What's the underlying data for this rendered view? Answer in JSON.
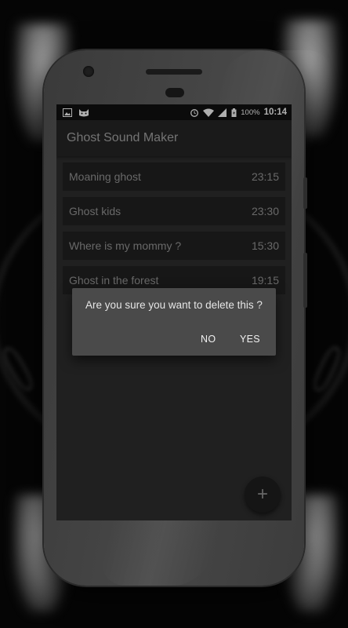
{
  "status_bar": {
    "battery": "100%",
    "time": "10:14"
  },
  "app_bar": {
    "title": "Ghost Sound Maker"
  },
  "recordings": [
    {
      "name": "Moaning ghost",
      "duration": "23:15"
    },
    {
      "name": "Ghost kids",
      "duration": "23:30"
    },
    {
      "name": "Where is my mommy ?",
      "duration": "15:30"
    },
    {
      "name": "Ghost in the forest",
      "duration": "19:15"
    }
  ],
  "dialog": {
    "message": "Are you sure you want to delete this ?",
    "negative": "NO",
    "positive": "YES"
  },
  "fab": {
    "label": "+",
    "icon": "add-icon"
  },
  "icons": {
    "status_left": [
      "image-icon",
      "cat-face-icon"
    ],
    "status_right": [
      "alarm-icon",
      "wifi-icon",
      "signal-icon",
      "battery-icon"
    ]
  },
  "colors": {
    "screen_bg": "#2b2b2b",
    "app_bar": "#232323",
    "row_bg": "#1f1f1f",
    "dialog_bg": "#4a4a4a"
  }
}
